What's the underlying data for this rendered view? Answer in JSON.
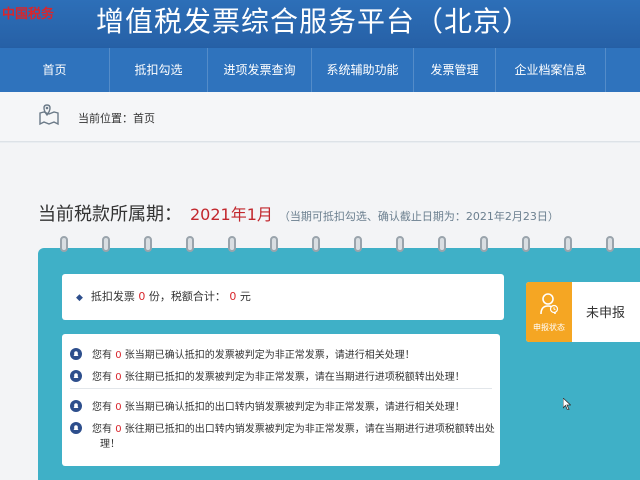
{
  "header": {
    "logo": "中国税务",
    "title": "增值税发票综合服务平台（北京）"
  },
  "nav": {
    "items": [
      "首页",
      "抵扣勾选",
      "进项发票查询",
      "系统辅助功能",
      "发票管理",
      "企业档案信息"
    ]
  },
  "breadcrumb": {
    "text": "当前位置：首页"
  },
  "period": {
    "label": "当前税款所属期：",
    "value": "2021年1月",
    "note": "（当期可抵扣勾选、确认截止日期为：2021年2月23日）"
  },
  "summary": {
    "prefix": "抵扣发票",
    "count": "0",
    "mid": "份，税额合计：",
    "amount": "0",
    "suffix": "元"
  },
  "status": {
    "caption": "申报状态",
    "text": "未申报"
  },
  "notices": [
    {
      "prefix": "您有",
      "count": "0",
      "text": "张当期已确认抵扣的发票被判定为非正常发票，请进行相关处理！"
    },
    {
      "prefix": "您有",
      "count": "0",
      "text": "张往期已抵扣的发票被判定为非正常发票，请在当期进行进项税额转出处理！"
    },
    {
      "prefix": "您有",
      "count": "0",
      "text": "张当期已确认抵扣的出口转内销发票被判定为非正常发票，请进行相关处理！"
    },
    {
      "prefix": "您有",
      "count": "0",
      "text": "张往期已抵扣的出口转内销发票被判定为非正常发票，请在当期进行进项税额转出处",
      "wrap": "理！"
    }
  ],
  "colors": {
    "header_blue": "#2d6fb8",
    "panel_teal": "#3fb0c7",
    "accent_red": "#c2272d",
    "status_orange": "#f5a623"
  }
}
